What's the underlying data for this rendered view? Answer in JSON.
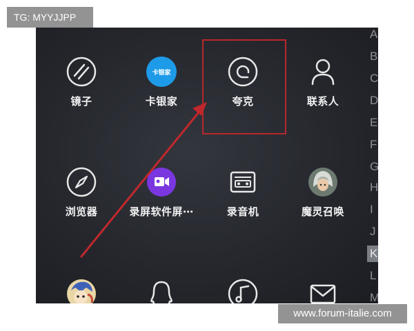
{
  "watermarks": {
    "top_left": "TG: MYYJJPP",
    "bottom_right": "www.forum-italie.com"
  },
  "apps": [
    {
      "label": "镜子",
      "icon": "mirror-icon"
    },
    {
      "label": "卡银家",
      "icon": "kayinjia-icon",
      "icon_text": "卡银家",
      "color": "#1e9be8"
    },
    {
      "label": "夸克",
      "icon": "quark-icon"
    },
    {
      "label": "联系人",
      "icon": "contacts-icon"
    },
    {
      "label": "浏览器",
      "icon": "browser-compass-icon"
    },
    {
      "label": "录屏软件屏⋯",
      "icon": "screen-recorder-icon",
      "color": "#7a37e0"
    },
    {
      "label": "录音机",
      "icon": "recorder-icon"
    },
    {
      "label": "魔灵召唤",
      "icon": "summoners-war-icon"
    },
    {
      "label": "",
      "icon": "game-character-icon"
    },
    {
      "label": "",
      "icon": "qq-penguin-icon"
    },
    {
      "label": "",
      "icon": "music-icon"
    },
    {
      "label": "",
      "icon": "mail-icon"
    }
  ],
  "alphabet_index": {
    "letters": [
      "A",
      "B",
      "C",
      "D",
      "E",
      "F",
      "G",
      "H",
      "I",
      "J",
      "K",
      "L",
      "M"
    ],
    "selected": "K"
  },
  "annotation": {
    "highlight_color": "#b8272c",
    "arrow_color": "#c0282d"
  }
}
